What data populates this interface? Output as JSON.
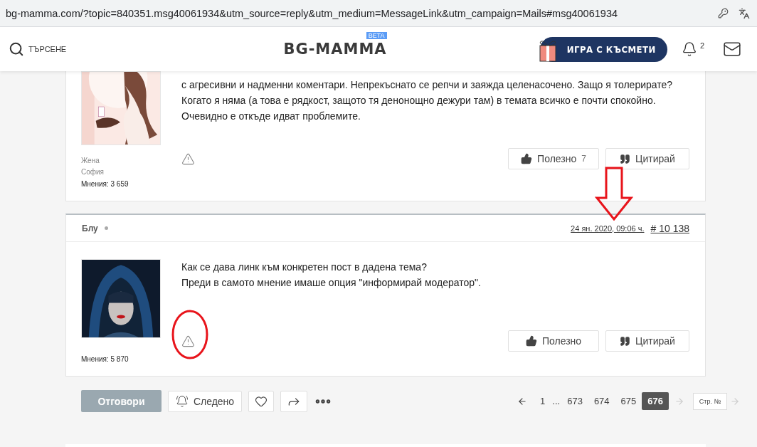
{
  "address_bar": {
    "url": "bg-mamma.com/?topic=840351.msg40061934&utm_source=reply&utm_medium=MessageLink&utm_campaign=Mails#msg40061934"
  },
  "header": {
    "search_label": "ТЪРСЕНЕ",
    "logo": "BG-MAMMA",
    "logo_badge": "BETA",
    "promo": "ИГРА С КЪСМЕТИ",
    "notifications": "2"
  },
  "posts": [
    {
      "text_lines": [
        "с агресивни и надменни коментари. Непрекъснато се репчи и заяжда целенасочено. Защо я толерирате?",
        "Когато я няма (а това е рядкост, защото тя денонощно дежури там) в темата всичко е почти спокойно.",
        "Очевидно е откъде идват проблемите."
      ],
      "profile": [
        "Жена",
        "София"
      ],
      "opinions": "Мнения: 3 659",
      "useful": {
        "label": "Полезно",
        "count": "7"
      },
      "quote": "Цитирай"
    },
    {
      "author": "Блу",
      "date": "24 ян. 2020, 09:06 ч.",
      "number": "# 10 138",
      "text_lines": [
        "Как се дава линк към конкретен пост в дадена тема?",
        "Преди в самото мнение имаше опция \"информирай модератор\"."
      ],
      "opinions": "Мнения: 5 870",
      "useful": {
        "label": "Полезно"
      },
      "quote": "Цитирай"
    }
  ],
  "actions": {
    "reply": "Отговори",
    "follow": "Следено"
  },
  "pagination": {
    "pages": [
      {
        "kind": "page",
        "label": "1",
        "selected": false
      },
      {
        "kind": "gap",
        "label": "..."
      },
      {
        "kind": "page",
        "label": "673",
        "selected": false
      },
      {
        "kind": "page",
        "label": "674",
        "selected": false
      },
      {
        "kind": "page",
        "label": "675",
        "selected": false
      },
      {
        "kind": "page",
        "label": "676",
        "selected": true
      }
    ],
    "page_input_placeholder": "Стр. №"
  }
}
